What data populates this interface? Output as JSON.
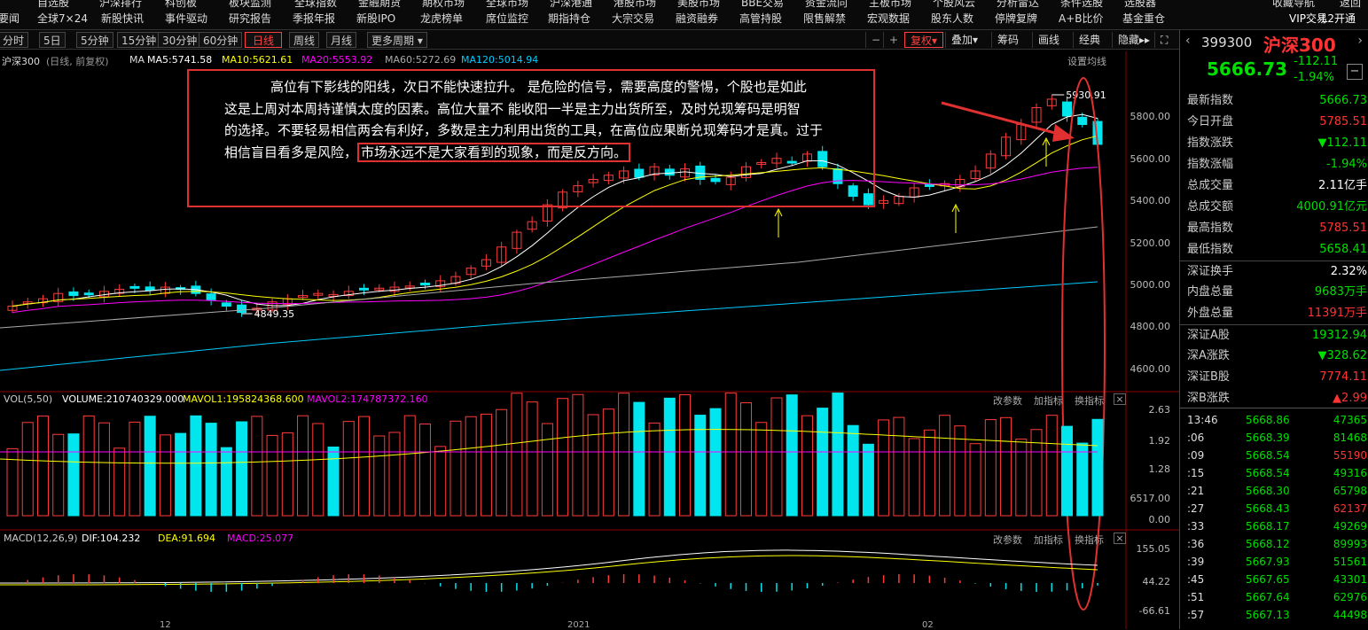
{
  "topnav": {
    "row1": [
      "自选股",
      "沪深排行",
      "科创板",
      "板块监测",
      "全球指数",
      "金融期货",
      "期权市场",
      "全球市场",
      "沪深港通",
      "港股市场",
      "美股市场",
      "BBE交易",
      "资金流向",
      "主板市场",
      "个股风云",
      "分析雷达",
      "条件选股",
      "选股器"
    ],
    "row2": [
      "要闻",
      "全球7×24",
      "新股快讯",
      "事件驱动",
      "研究报告",
      "季报年报",
      "新股IPO",
      "龙虎榜单",
      "席位监控",
      "期指持仓",
      "大宗交易",
      "融资融券",
      "高管持股",
      "限售解禁",
      "宏观数据",
      "股东人数",
      "停牌复牌",
      "A+B比价",
      "基金重仓"
    ],
    "right1": "收藏导航",
    "right1b": "返回",
    "vip": "VIP交易",
    "l2": "L2开通"
  },
  "period_tabs": [
    "分时",
    "5日",
    "5分钟",
    "15分钟",
    "30分钟",
    "60分钟",
    "日线",
    "周线",
    "月线",
    "更多周期"
  ],
  "active_period": "日线",
  "toolbar": {
    "fuquan": "复权",
    "add": "叠加",
    "chip": "筹码",
    "draw": "画线",
    "classic": "经典",
    "hide": "隐藏"
  },
  "ma_legend": {
    "title": "沪深300",
    "mode": "(日线, 前复权)",
    "ma": "MA",
    "ma5": "MA5:5741.58",
    "ma10": "MA10:5621.61",
    "ma20": "MA20:5553.92",
    "ma60": "MA60:5272.69",
    "ma120": "MA120:5014.94",
    "settings": "设置均线"
  },
  "price_axis": [
    "5800.00",
    "5600.00",
    "5400.00",
    "5200.00",
    "5000.00",
    "4800.00",
    "4600.00"
  ],
  "annotations": {
    "high": "5930.91",
    "low": "4849.35"
  },
  "annotation_box": {
    "line1": "高位有下影线的阳线，次日不能快速拉升。 是危险的信号，需要高度的警惕，个股也是如此",
    "line2": "这是上周对本周持谨慎太度的因素。高位大量不  能收阳一半是主力出货所至，及时兑现筹码是明智",
    "line3": "的选择。不要轻易相信两会有利好，多数是主力利用出货的工具，在高位应果断兑现筹码才是真。过于",
    "line4a": "相信盲目看多是风险，",
    "line4b": "市场永远不是大家看到的现象，而是反方向。"
  },
  "vol_legend": {
    "name": "VOL(5,50)",
    "volume": "VOLUME:210740329.000",
    "mavol1": "MAVOL1:195824368.600",
    "mavol2": "MAVOL2:174787372.160",
    "btns": [
      "改参数",
      "加指标",
      "换指标"
    ]
  },
  "vol_axis": [
    "2.63",
    "1.92",
    "1.28",
    "6517.00",
    "0.00"
  ],
  "macd_legend": {
    "name": "MACD(12,26,9)",
    "dif": "DIF:104.232",
    "dea": "DEA:91.694",
    "macd": "MACD:25.077",
    "btns": [
      "改参数",
      "加指标",
      "换指标"
    ]
  },
  "macd_axis": [
    "155.05",
    "44.22",
    "-66.61"
  ],
  "x_axis": [
    "12",
    "2021",
    "02"
  ],
  "right": {
    "code": "399300",
    "name": "沪深300",
    "price": "5666.73",
    "change": "-112.11",
    "pct": "-1.94%",
    "rows": [
      {
        "label": "最新指数",
        "value": "5666.73",
        "color": "green"
      },
      {
        "label": "今日开盘",
        "value": "5785.51",
        "color": "red"
      },
      {
        "label": "指数涨跌",
        "value": "▼112.11",
        "color": "green"
      },
      {
        "label": "指数涨幅",
        "value": "-1.94%",
        "color": "green"
      },
      {
        "label": "总成交量",
        "value": "2.11亿手",
        "color": "white"
      },
      {
        "label": "总成交额",
        "value": "4000.91亿元",
        "color": "green"
      },
      {
        "label": "最高指数",
        "value": "5785.51",
        "color": "red"
      },
      {
        "label": "最低指数",
        "value": "5658.41",
        "color": "green"
      },
      {
        "label": "深证换手",
        "value": "2.32%",
        "color": "white"
      },
      {
        "label": "内盘总量",
        "value": "9683万手",
        "color": "green"
      },
      {
        "label": "外盘总量",
        "value": "11391万手",
        "color": "red"
      },
      {
        "label": "深证A股",
        "value": "19312.94",
        "color": "green"
      },
      {
        "label": "深A涨跌",
        "value": "▼328.62",
        "color": "green"
      },
      {
        "label": "深证B股",
        "value": "7774.11",
        "color": "red"
      },
      {
        "label": "深B涨跌",
        "value": "▲2.99",
        "color": "red"
      }
    ],
    "ticks": [
      {
        "t": "13:46",
        "p": "5668.86",
        "v": "47365",
        "c": "green"
      },
      {
        "t": ":06",
        "p": "5668.39",
        "v": "81468",
        "c": "green"
      },
      {
        "t": ":09",
        "p": "5668.54",
        "v": "55190",
        "c": "red"
      },
      {
        "t": ":15",
        "p": "5668.54",
        "v": "49316",
        "c": "green"
      },
      {
        "t": ":21",
        "p": "5668.30",
        "v": "65798",
        "c": "green"
      },
      {
        "t": ":27",
        "p": "5668.43",
        "v": "62137",
        "c": "red"
      },
      {
        "t": ":33",
        "p": "5668.17",
        "v": "49269",
        "c": "green"
      },
      {
        "t": ":36",
        "p": "5668.12",
        "v": "89993",
        "c": "green"
      },
      {
        "t": ":39",
        "p": "5667.93",
        "v": "51561",
        "c": "green"
      },
      {
        "t": ":45",
        "p": "5667.65",
        "v": "43301",
        "c": "green"
      },
      {
        "t": ":51",
        "p": "5667.64",
        "v": "62976",
        "c": "green"
      },
      {
        "t": ":57",
        "p": "5667.13",
        "v": "44498",
        "c": "green"
      }
    ]
  },
  "colors": {
    "up": "#ff3b3b",
    "down": "#00e5ee",
    "ma5": "#ffffff",
    "ma10": "#ffff00",
    "ma20": "#ff00ff",
    "ma60": "#aaaaaa",
    "ma120": "#00ccff",
    "annot": "#e03030"
  }
}
